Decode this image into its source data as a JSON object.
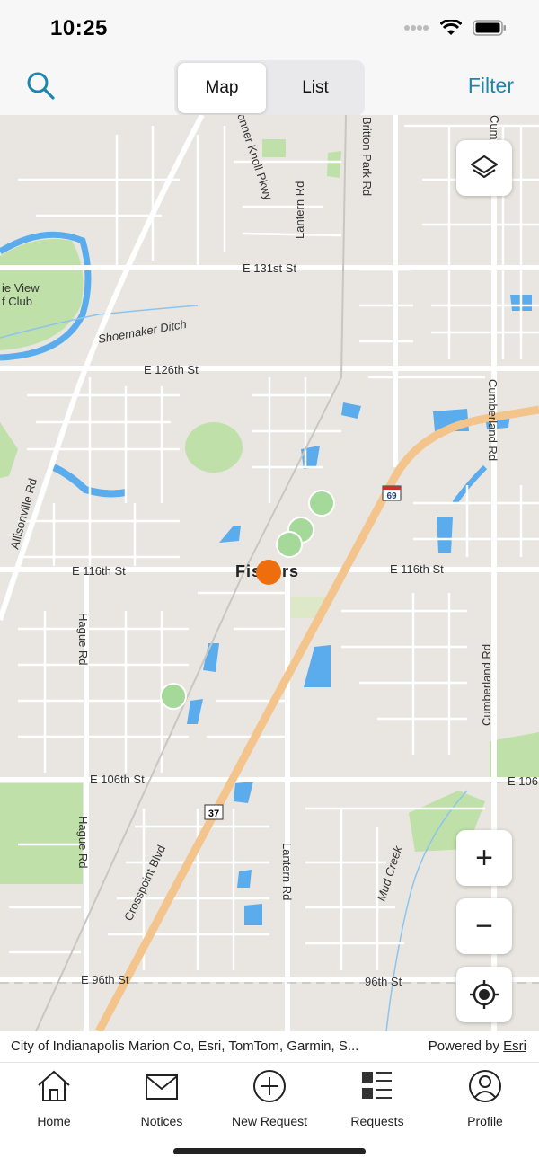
{
  "status": {
    "time": "10:25"
  },
  "header": {
    "segments": {
      "map_label": "Map",
      "list_label": "List",
      "active": "Map"
    },
    "filter_label": "Filter"
  },
  "map": {
    "labels": {
      "e131": "E 131st St",
      "shoemaker": "Shoemaker Ditch",
      "e126": "E 126th St",
      "e116_west": "E 116th St",
      "e116_east": "E 116th St",
      "fishers": "Fishers",
      "e106": "E 106th St",
      "e106_east": "E 106",
      "e96": "E 96th St",
      "e96_east": "96th St",
      "allisonville": "Allisonville Rd",
      "hague1": "Hague Rd",
      "hague2": "Hague Rd",
      "crosspoint": "Crosspoint Blvd",
      "lantern_north": "Lantern Rd",
      "lantern_south": "Lantern Rd",
      "britton": "Britton Park Rd",
      "cumberland_n": "Cumberland Rd",
      "cumberland_s": "Cumberland Rd",
      "cumb_top": "Cum",
      "conner": "onner Knoll Pkwy",
      "mud_creek": "Mud Creek",
      "club1": "ie View",
      "club2": "f Club",
      "shield_69": "69",
      "shield_37": "37"
    },
    "markers": [
      {
        "type": "request",
        "color": "#a5d99a"
      },
      {
        "type": "request",
        "color": "#a5d99a"
      },
      {
        "type": "request",
        "color": "#a5d99a"
      },
      {
        "type": "request",
        "color": "#a5d99a"
      },
      {
        "type": "current",
        "color": "#ee6e0e"
      }
    ],
    "controls": {
      "zoom_in": "+",
      "zoom_out": "−"
    }
  },
  "attribution": {
    "text": "City of Indianapolis Marion Co, Esri, TomTom, Garmin, S...",
    "powered": "Powered by",
    "esri": "Esri"
  },
  "tabs": [
    {
      "label": "Home",
      "icon": "home-icon"
    },
    {
      "label": "Notices",
      "icon": "envelope-icon"
    },
    {
      "label": "New Request",
      "icon": "plus-circle-icon"
    },
    {
      "label": "Requests",
      "icon": "list-icon"
    },
    {
      "label": "Profile",
      "icon": "person-icon"
    }
  ],
  "colors": {
    "accent": "#1d86b0",
    "highway": "#f3c48c",
    "water": "#5aacec",
    "park": "#bfe0a8"
  }
}
